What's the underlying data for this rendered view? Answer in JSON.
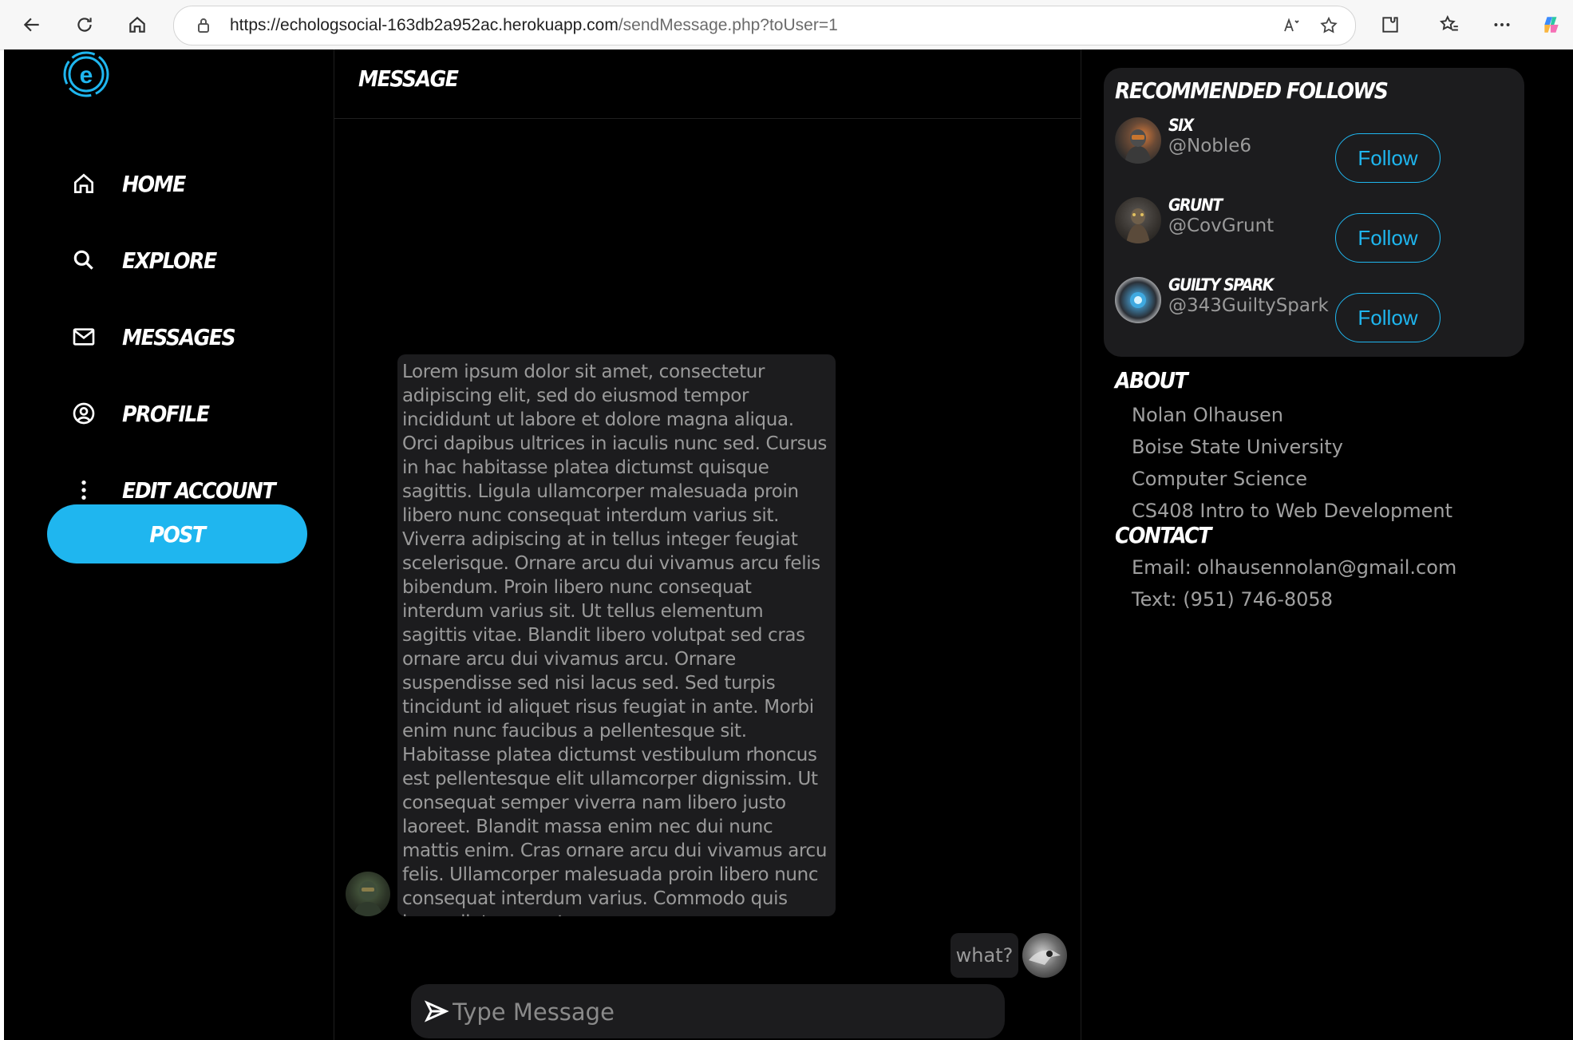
{
  "browser": {
    "url_host": "https://echologsocial-163db2a952ac.herokuapp.com",
    "url_path": "/sendMessage.php?toUser=1",
    "icons": [
      "back-arrow-icon",
      "refresh-icon",
      "home-icon",
      "site-info-icon",
      "read-aloud-icon",
      "favorite-star-icon",
      "extensions-icon",
      "favorites-icon",
      "more-icon",
      "copilot-icon"
    ]
  },
  "sidebar": {
    "logo_icon": "echolog-logo-icon",
    "items": [
      {
        "label": "HOME",
        "icon": "home-icon"
      },
      {
        "label": "EXPLORE",
        "icon": "search-icon"
      },
      {
        "label": "MESSAGES",
        "icon": "mail-icon"
      },
      {
        "label": "PROFILE",
        "icon": "user-circle-icon"
      },
      {
        "label": "EDIT ACCOUNT",
        "icon": "kebab-menu-icon"
      }
    ],
    "post_label": "POST"
  },
  "chat": {
    "title": "MESSAGE",
    "incoming_text": "Lorem ipsum dolor sit amet, consectetur adipiscing elit, sed do eiusmod tempor incididunt ut labore et dolore magna aliqua. Orci dapibus ultrices in iaculis nunc sed. Cursus in hac habitasse platea dictumst quisque sagittis. Ligula ullamcorper malesuada proin libero nunc consequat interdum varius sit. Viverra adipiscing at in tellus integer feugiat scelerisque. Ornare arcu dui vivamus arcu felis bibendum. Proin libero nunc consequat interdum varius sit. Ut tellus elementum sagittis vitae. Blandit libero volutpat sed cras ornare arcu dui vivamus arcu. Ornare suspendisse sed nisi lacus sed. Sed turpis tincidunt id aliquet risus feugiat in ante. Morbi enim nunc faucibus a pellentesque sit. Habitasse platea dictumst vestibulum rhoncus est pellentesque elit ullamcorper dignissim. Ut consequat semper viverra nam libero justo laoreet. Blandit massa enim nec dui nunc mattis enim. Cras ornare arcu dui vivamus arcu felis. Ullamcorper malesuada proin libero nunc consequat interdum varius. Commodo quis imperdiet massa t",
    "outgoing_text": "what?",
    "input_placeholder": "Type Message",
    "input_value": ""
  },
  "recommended": {
    "title": "RECOMMENDED FOLLOWS",
    "users": [
      {
        "name": "SIX",
        "handle": "@Noble6",
        "button": "Follow"
      },
      {
        "name": "GRUNT",
        "handle": "@CovGrunt",
        "button": "Follow"
      },
      {
        "name": "GUILTY SPARK",
        "handle": "@343GuiltySpark",
        "button": "Follow"
      }
    ]
  },
  "about": {
    "title": "ABOUT",
    "lines": [
      "Nolan Olhausen",
      "Boise State University",
      "Computer Science",
      "CS408 Intro to Web Development"
    ]
  },
  "contact": {
    "title": "CONTACT",
    "lines": [
      "Email: olhausennolan@gmail.com",
      "Text: (951) 746-8058"
    ]
  },
  "colors": {
    "accent": "#1fb6ef",
    "background": "#000000",
    "card": "#1c1c1e"
  }
}
